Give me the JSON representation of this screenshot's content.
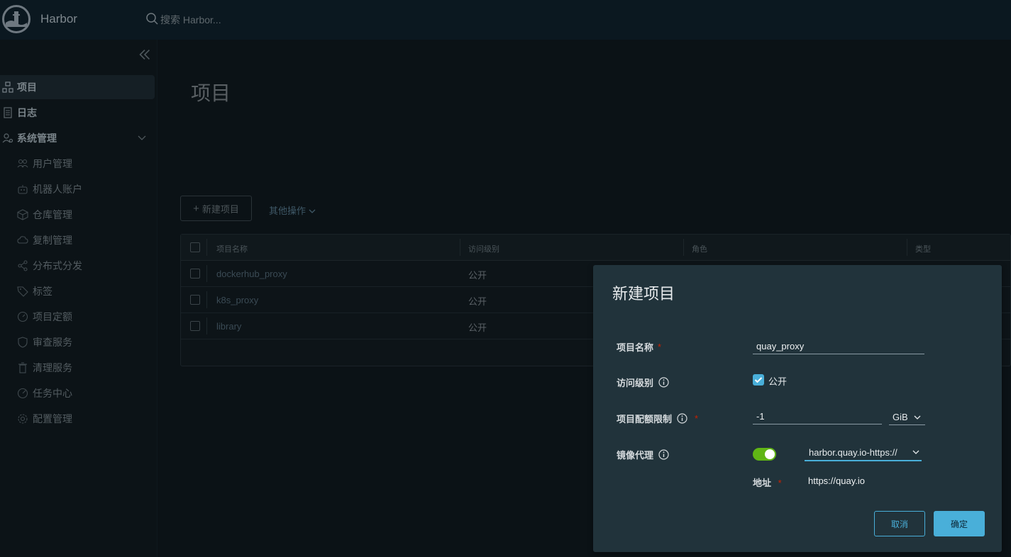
{
  "header": {
    "app_title": "Harbor",
    "search_placeholder": "搜索 Harbor..."
  },
  "sidebar": {
    "items": [
      {
        "label": "项目",
        "icon": "projects-icon",
        "active": true
      },
      {
        "label": "日志",
        "icon": "logs-icon"
      },
      {
        "label": "系统管理",
        "icon": "admin-icon",
        "expanded": true
      }
    ],
    "sub_items": [
      {
        "label": "用户管理",
        "icon": "users-icon"
      },
      {
        "label": "机器人账户",
        "icon": "robot-icon"
      },
      {
        "label": "仓库管理",
        "icon": "registry-icon"
      },
      {
        "label": "复制管理",
        "icon": "cloud-replication-icon"
      },
      {
        "label": "分布式分发",
        "icon": "share-icon"
      },
      {
        "label": "标签",
        "icon": "tag-icon"
      },
      {
        "label": "项目定额",
        "icon": "quota-icon"
      },
      {
        "label": "审查服务",
        "icon": "shield-icon"
      },
      {
        "label": "清理服务",
        "icon": "trash-icon"
      },
      {
        "label": "任务中心",
        "icon": "dashboard-icon"
      },
      {
        "label": "配置管理",
        "icon": "gear-icon"
      }
    ]
  },
  "main": {
    "page_title": "项目",
    "new_project_label": "新建项目",
    "other_ops_label": "其他操作",
    "columns": [
      "项目名称",
      "访问级别",
      "角色",
      "类型"
    ],
    "rows": [
      {
        "name": "dockerhub_proxy",
        "access": "公开"
      },
      {
        "name": "k8s_proxy",
        "access": "公开"
      },
      {
        "name": "library",
        "access": "公开"
      }
    ]
  },
  "modal": {
    "title": "新建项目",
    "project_name_label": "项目名称",
    "project_name_value": "quay_proxy",
    "access_label": "访问级别",
    "public_label": "公开",
    "public_checked": true,
    "quota_label": "项目配额限制",
    "quota_value": "-1",
    "quota_unit": "GiB",
    "proxy_label": "镜像代理",
    "proxy_enabled": true,
    "proxy_registry": "harbor.quay.io-https://",
    "address_label": "地址",
    "address_value": "https://quay.io",
    "cancel_label": "取消",
    "ok_label": "确定"
  },
  "colors": {
    "accent": "#49afd9",
    "toggle_on": "#60b515",
    "required": "#c92100",
    "modal_bg": "#21333b"
  }
}
